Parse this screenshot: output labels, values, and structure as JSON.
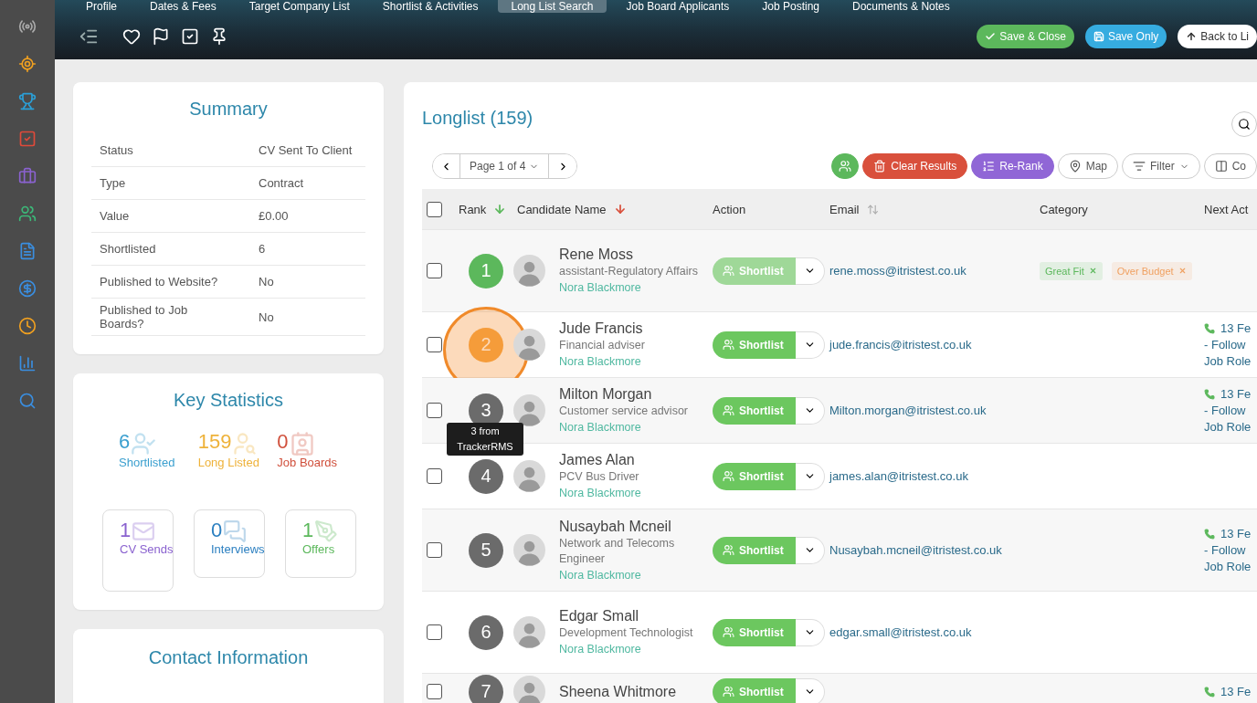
{
  "tabs": [
    {
      "label": "Profile",
      "selected": false
    },
    {
      "label": "Dates & Fees",
      "selected": false
    },
    {
      "label": "Target Company List",
      "selected": false
    },
    {
      "label": "Shortlist & Activities",
      "selected": false
    },
    {
      "label": "Long List Search",
      "selected": true
    },
    {
      "label": "Job Board Applicants",
      "selected": false
    },
    {
      "label": "Job Posting",
      "selected": false
    },
    {
      "label": "Documents & Notes",
      "selected": false
    }
  ],
  "header_actions": [
    {
      "kind": "save_close",
      "label": "Save & Close"
    },
    {
      "kind": "save",
      "label": "Save Only"
    },
    {
      "kind": "back",
      "label": "Back to Li"
    }
  ],
  "summary": {
    "title": "Summary",
    "rows": [
      {
        "label": "Status",
        "value": "CV Sent To Client"
      },
      {
        "label": "Type",
        "value": "Contract"
      },
      {
        "label": "Value",
        "value": "£0.00"
      },
      {
        "label": "Shortlisted",
        "value": "6"
      },
      {
        "label": "Published to Website?",
        "value": "No"
      },
      {
        "label": "Published to Job Boards?",
        "value": "No"
      }
    ]
  },
  "key_statistics": {
    "title": "Key Statistics",
    "stats": [
      {
        "kind": "plain",
        "value": "6",
        "label": "Shortlisted",
        "color": "#3a9fcf"
      },
      {
        "kind": "plain",
        "value": "159",
        "label": "Long Listed",
        "color": "#eeb23a"
      },
      {
        "kind": "plain",
        "value": "0",
        "label": "Job Boards",
        "color": "#d0503c"
      },
      {
        "kind": "boxed",
        "value": "1",
        "label": "CV Sends",
        "color": "#8a62cf"
      },
      {
        "kind": "boxed",
        "value": "0",
        "label": "Interviews",
        "color": "#2b7fc0"
      },
      {
        "kind": "boxed",
        "value": "1",
        "label": "Offers",
        "color": "#5cb85c"
      }
    ]
  },
  "contact": {
    "title": "Contact Information"
  },
  "longlist": {
    "title": "Longlist (159)",
    "pager": "Page 1 of 4",
    "tools": [
      {
        "kind": "users"
      },
      {
        "kind": "clear",
        "label": "Clear Results"
      },
      {
        "kind": "rerank",
        "label": "Re-Rank"
      },
      {
        "kind": "map",
        "label": "Map"
      },
      {
        "kind": "filter",
        "label": "Filter"
      },
      {
        "kind": "columns",
        "label": "Co"
      }
    ],
    "select_all": {
      "checked": false
    },
    "columns": [
      {
        "label": "Rank",
        "sorted": true,
        "color": "#5cb85c"
      },
      {
        "label": "Candidate Name",
        "sorted": true,
        "color": "#d9503c"
      },
      {
        "label": "Action",
        "sorted": false,
        "sortable": false
      },
      {
        "label": "Email",
        "sorted": false,
        "sortable": true
      },
      {
        "label": "Category",
        "sorted": false,
        "sortable": false
      },
      {
        "label": "Next Act"
      }
    ],
    "rows": [
      {
        "checked": false,
        "rank": "1",
        "color": "#5cb85c",
        "highlighted": false,
        "name": "Rene Moss",
        "title": "assistant-Regulatory Affairs",
        "owner": "Nora Blackmore",
        "action": "Shortlist",
        "action_disabled": true,
        "email": "rene.moss@itristest.co.uk",
        "categories": [
          {
            "label": "Great Fit",
            "color": "#5cb85c"
          },
          {
            "label": "Over Budget",
            "color": "#f0a060"
          }
        ],
        "next_action": []
      },
      {
        "checked": false,
        "rank": "2",
        "color": "#f5a03a",
        "highlighted": true,
        "name": "Jude Francis",
        "title": "Financial adviser",
        "owner": "Nora Blackmore",
        "action": "Shortlist",
        "action_disabled": false,
        "email": "jude.francis@itristest.co.uk",
        "categories": [],
        "next_action": [
          "13 Fe",
          "- Follow",
          "Job Role"
        ]
      },
      {
        "checked": false,
        "rank": "3",
        "color": "#6b6b6b",
        "highlighted": false,
        "tooltip": "3 from TrackerRMS",
        "name": "Milton Morgan",
        "title": "Customer service advisor",
        "owner": "Nora Blackmore",
        "action": "Shortlist",
        "action_disabled": false,
        "email": "Milton.morgan@itristest.co.uk",
        "categories": [],
        "next_action": [
          "13 Fe",
          "- Follow",
          "Job Role"
        ]
      },
      {
        "checked": false,
        "rank": "4",
        "color": "#6b6b6b",
        "highlighted": false,
        "name": "James Alan",
        "title": "PCV Bus Driver",
        "owner": "Nora Blackmore",
        "action": "Shortlist",
        "action_disabled": false,
        "email": "james.alan@itristest.co.uk",
        "categories": [],
        "next_action": []
      },
      {
        "checked": false,
        "rank": "5",
        "color": "#6b6b6b",
        "highlighted": false,
        "name": "Nusaybah Mcneil",
        "title": "Network and Telecoms Engineer",
        "owner": "Nora Blackmore",
        "action": "Shortlist",
        "action_disabled": false,
        "email": "Nusaybah.mcneil@itristest.co.uk",
        "categories": [],
        "next_action": [
          "13 Fe",
          "- Follow",
          "Job Role"
        ]
      },
      {
        "checked": false,
        "rank": "6",
        "color": "#6b6b6b",
        "highlighted": false,
        "name": "Edgar Small",
        "title": "Development Technologist",
        "owner": "Nora Blackmore",
        "action": "Shortlist",
        "action_disabled": false,
        "email": "edgar.small@itristest.co.uk",
        "categories": [],
        "next_action": []
      },
      {
        "checked": false,
        "rank": "7",
        "color": "#6b6b6b",
        "highlighted": false,
        "name": "Sheena Whitmore",
        "action": "Shortlist",
        "action_disabled": false,
        "categories": [],
        "next_action": [
          "13 Fe"
        ]
      }
    ]
  }
}
